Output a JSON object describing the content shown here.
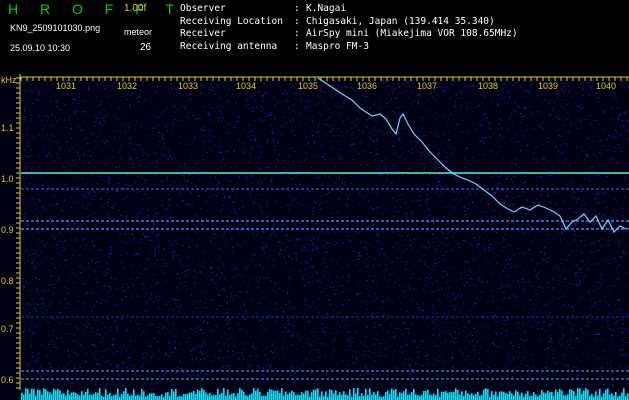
{
  "header": {
    "brand": "H R O F F T",
    "version": "1.00f",
    "filename": "KN9_2509101030.png",
    "datetime": "25.09.10 10:30",
    "meteor_label": "meteor",
    "meteor_count": "26"
  },
  "info": [
    {
      "key": "Observer",
      "sep": ":",
      "value": "K.Nagai"
    },
    {
      "key": "Receiving Location",
      "sep": ":",
      "value": "Chigasaki, Japan (139.414 35.340)"
    },
    {
      "key": "Receiver",
      "sep": ":",
      "value": "AirSpy mini (Miakejima VOR 108.65MHz)"
    },
    {
      "key": "Receiving antenna",
      "sep": ":",
      "value": "Maspro FM-3"
    }
  ],
  "spectrogram": {
    "unit": "kHz",
    "y_labels": [
      "1.1",
      "1.0",
      "0.9",
      "0.8",
      "0.7",
      "0.6"
    ],
    "x_labels": [
      "1031",
      "1032",
      "1033",
      "1034",
      "1035",
      "1036",
      "1037",
      "1038",
      "1039",
      "1040"
    ],
    "colors": {
      "background": "#000014",
      "noise": "#1f2ec8",
      "axis": "#e6d000",
      "carrier": "#5fffd0",
      "trace": "#60e0ff",
      "floor": "#00e5ff"
    },
    "carrier_khz": 1.01
  }
}
